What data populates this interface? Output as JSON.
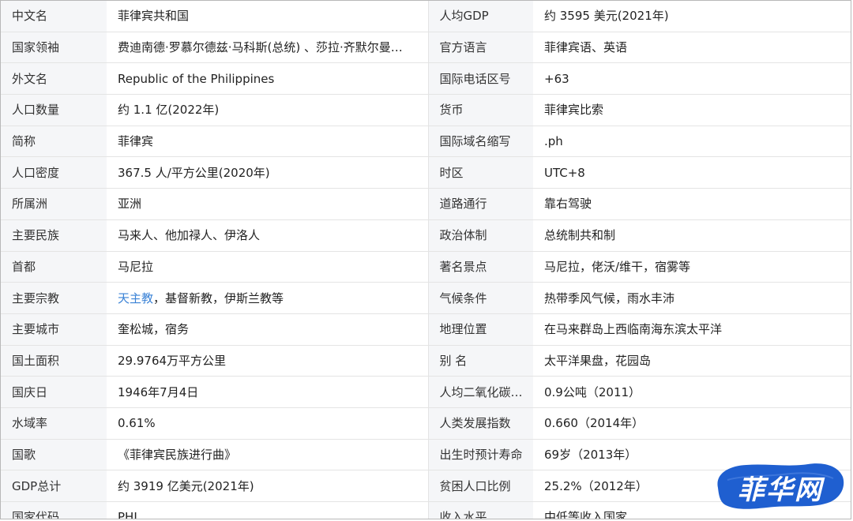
{
  "rows": [
    {
      "k1": "中文名",
      "v1": "菲律宾共和国",
      "k2": "人均GDP",
      "v2": "约 3595 美元(2021年)"
    },
    {
      "k1": "国家领袖",
      "v1": "费迪南德·罗慕尔德兹·马科斯(总统) 、莎拉·齐默尔曼…",
      "k2": "官方语言",
      "v2": "菲律宾语、英语"
    },
    {
      "k1": "外文名",
      "v1": "Republic of the Philippines",
      "k2": "国际电话区号",
      "v2": "+63"
    },
    {
      "k1": "人口数量",
      "v1": "约 1.1 亿(2022年)",
      "k2": "货币",
      "v2": "菲律宾比索"
    },
    {
      "k1": "简称",
      "v1": "菲律宾",
      "k2": "国际域名缩写",
      "v2": ".ph"
    },
    {
      "k1": "人口密度",
      "v1": "367.5 人/平方公里(2020年)",
      "k2": "时区",
      "v2": "UTC+8"
    },
    {
      "k1": "所属洲",
      "v1": "亚洲",
      "k2": "道路通行",
      "v2": "靠右驾驶"
    },
    {
      "k1": "主要民族",
      "v1": "马来人、他加禄人、伊洛人",
      "k2": "政治体制",
      "v2": "总统制共和制"
    },
    {
      "k1": "首都",
      "v1": "马尼拉",
      "k2": "著名景点",
      "v2": "马尼拉，佬沃/维干，宿雾等"
    },
    {
      "k1": "主要宗教",
      "v1_link": "天主教",
      "v1_rest": "，基督新教，伊斯兰教等",
      "k2": "气候条件",
      "v2": "热带季风气候，雨水丰沛"
    },
    {
      "k1": "主要城市",
      "v1": "奎松城，宿务",
      "k2": "地理位置",
      "v2": "在马来群岛上西临南海东滨太平洋"
    },
    {
      "k1": "国土面积",
      "v1": "29.9764万平方公里",
      "k2": "别 名",
      "v2": "太平洋果盘，花园岛"
    },
    {
      "k1": "国庆日",
      "v1": "1946年7月4日",
      "k2": "人均二氧化碳…",
      "v2": "0.9公吨（2011）"
    },
    {
      "k1": "水域率",
      "v1": "0.61%",
      "k2": "人类发展指数",
      "v2": "0.660（2014年）"
    },
    {
      "k1": "国歌",
      "v1": "《菲律宾民族进行曲》",
      "k2": "出生时预计寿命",
      "v2": "69岁（2013年）"
    },
    {
      "k1": "GDP总计",
      "v1": "约 3919 亿美元(2021年)",
      "k2": "贫困人口比例",
      "v2": "25.2%（2012年）"
    },
    {
      "k1": "国家代码",
      "v1": "PHL",
      "k2": "收入水平",
      "v2": "中低等收入国家"
    }
  ],
  "watermark": {
    "text": "菲华网",
    "color": "#1f5fd0"
  },
  "colors": {
    "key_bg": "#f5f6f8",
    "link": "#3a82d6",
    "border": "#e4e4e4"
  }
}
